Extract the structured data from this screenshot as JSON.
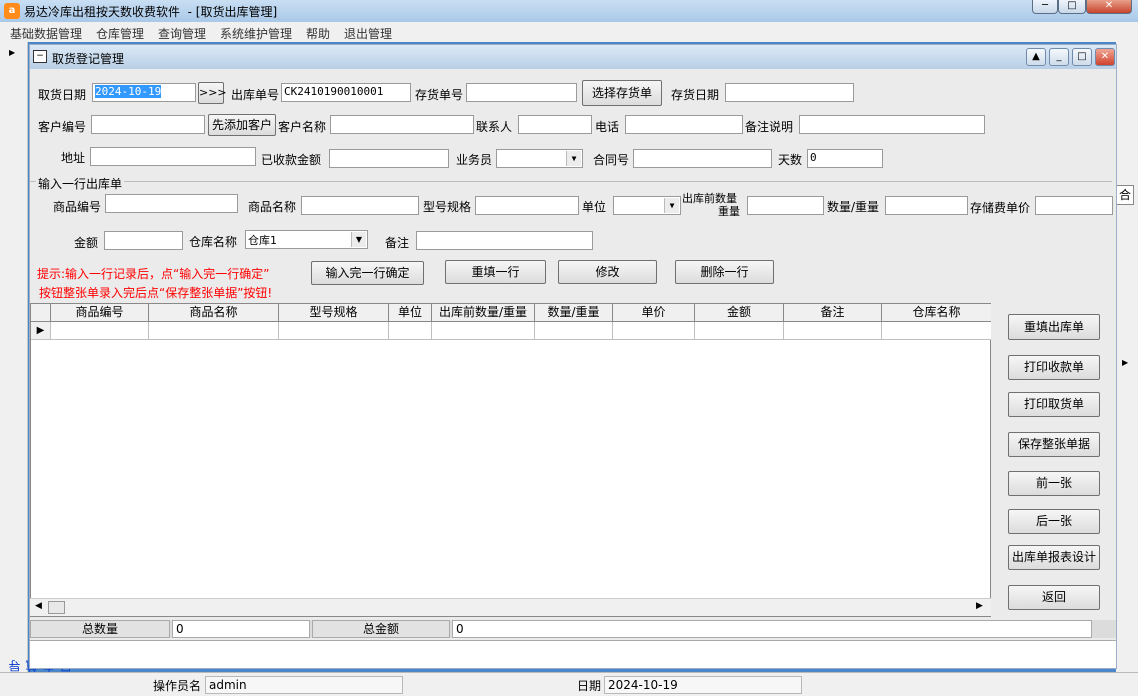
{
  "window": {
    "icon_text": "a",
    "title": "易达冷库出租按天数收费软件  - [取货出库管理]",
    "minimize": "─",
    "maximize": "□",
    "close": "✕"
  },
  "menu": [
    "基础数据管理",
    "仓库管理",
    "查询管理",
    "系统维护管理",
    "帮助",
    "退出管理"
  ],
  "left_nav": {
    "arrow": "▶",
    "label": "导航向导"
  },
  "right_fragment": "合",
  "right_arrow": "▶",
  "child": {
    "title": "取货登记管理",
    "icon": "−",
    "btn_up": "▲",
    "btn_min": "_",
    "btn_max": "□",
    "btn_close": "✕"
  },
  "form": {
    "pickup_date_label": "取货日期",
    "pickup_date_value": "2024-10-19",
    "date_btn": ">>>",
    "out_no_label": "出库单号",
    "out_no_value": "CK2410190010001",
    "stock_no_label": "存货单号",
    "stock_no_value": "",
    "select_stock_btn": "选择存货单",
    "stock_date_label": "存货日期",
    "stock_date_value": "",
    "customer_no_label": "客户编号",
    "add_customer_btn": "先添加客户",
    "customer_name_label": "客户名称",
    "contact_label": "联系人",
    "phone_label": "电话",
    "remark_desc_label": "备注说明",
    "address_label": "地址",
    "received_label": "已收款金额",
    "salesman_label": "业务员",
    "contract_label": "合同号",
    "days_label": "天数",
    "days_value": "0",
    "group_title": "输入一行出库单",
    "product_no_label": "商品编号",
    "product_name_label": "商品名称",
    "spec_label": "型号规格",
    "unit_label": "单位",
    "before_qty_label_1": "出库前数量",
    "before_qty_label_2": "重量",
    "qty_label": "数量/重量",
    "price_label": "存储费单价",
    "amount_label": "金额",
    "warehouse_label": "仓库名称",
    "warehouse_value": "仓库1",
    "note_label": "备注",
    "hint1": "提示:输入一行记录后，点“输入完一行确定”",
    "hint2": "按钮整张单录入完后点“保存整张单据”按钮!",
    "confirm_row_btn": "输入完一行确定",
    "refill_row_btn": "重填一行",
    "edit_btn": "修改",
    "delete_row_btn": "删除一行"
  },
  "grid": {
    "row_marker": "▶",
    "columns": [
      "商品编号",
      "商品名称",
      "型号规格",
      "单位",
      "出库前数量/重量",
      "数量/重量",
      "单价",
      "金额",
      "备注",
      "仓库名称"
    ]
  },
  "side_buttons": [
    "重填出库单",
    "打印收款单",
    "打印取货单",
    "保存整张单据",
    "前一张",
    "后一张",
    "出库单报表设计",
    "返回"
  ],
  "summary": {
    "total_qty_label": "总数量",
    "total_qty_value": "0",
    "total_amount_label": "总金额",
    "total_amount_value": "0"
  },
  "status": {
    "operator_label": "操作员名",
    "operator_value": "admin",
    "date_label": "日期",
    "date_value": "2024-10-19"
  }
}
